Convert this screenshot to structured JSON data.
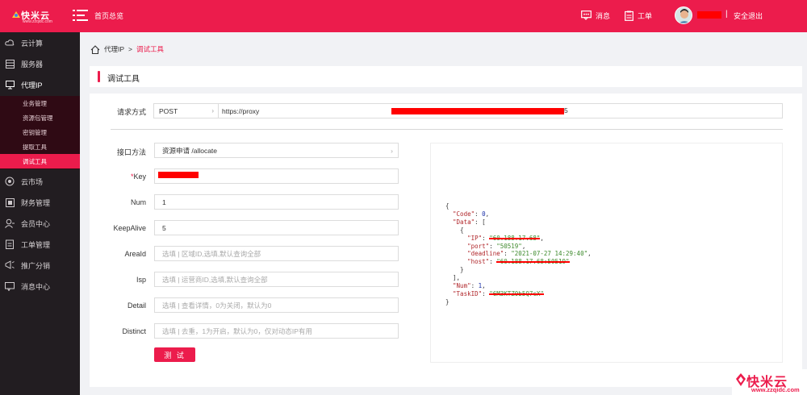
{
  "header": {
    "logo_name": "快米云",
    "logo_sub": "www.zzqidc.com",
    "home_label": "首页总览",
    "messages_label": "消息",
    "tickets_label": "工单",
    "separator": "|",
    "logout_label": "安全退出"
  },
  "sidebar": {
    "items": [
      {
        "label": "云计算",
        "icon": "cloud-icon"
      },
      {
        "label": "服务器",
        "icon": "server-icon"
      },
      {
        "label": "代理IP",
        "icon": "monitor-icon"
      },
      {
        "label": "云市场",
        "icon": "market-icon"
      },
      {
        "label": "财务管理",
        "icon": "finance-icon"
      },
      {
        "label": "会员中心",
        "icon": "user-icon"
      },
      {
        "label": "工单管理",
        "icon": "ticket-icon"
      },
      {
        "label": "推广分销",
        "icon": "promote-icon"
      },
      {
        "label": "消息中心",
        "icon": "message-icon"
      }
    ],
    "subitems": [
      "业务管理",
      "资源包管理",
      "密钥管理",
      "提取工具",
      "调试工具"
    ]
  },
  "breadcrumb": {
    "parent": "代理IP",
    "sep": ">",
    "current": "调试工具"
  },
  "page_title": "调试工具",
  "form": {
    "method_label": "请求方式",
    "method_value": "POST",
    "url_prefix": "https://proxy",
    "url_tail": "5",
    "api_label": "接口方法",
    "api_value": "资源申请  /allocate",
    "key_required": "*",
    "key_label": "Key",
    "num_label": "Num",
    "num_value": "1",
    "keepalive_label": "KeepAlive",
    "keepalive_value": "5",
    "areaid_label": "AreaId",
    "areaid_placeholder": "选填 | 区域ID,选填,默认查询全部",
    "isp_label": "Isp",
    "isp_placeholder": "选填 | 运营商ID,选填,默认查询全部",
    "detail_label": "Detail",
    "detail_placeholder": "选填 | 查看详情，0为关闭，默认为0",
    "distinct_label": "Distinct",
    "distinct_placeholder": "选填 | 去重，1为开启，默认为0，仅对动态IP有用",
    "test_button": "测 试"
  },
  "response": {
    "open_brace": "{",
    "close_brace": "}",
    "code_key": "\"Code\"",
    "code_val": "0",
    "data_key": "\"Data\"",
    "ip_key": "\"IP\"",
    "ip_val": "\"60.188.17.68\"",
    "port_key": "\"port\"",
    "port_val": "\"50519\"",
    "deadline_key": "\"deadline\"",
    "deadline_val": "\"2021-07-27 14:29:40\"",
    "host_key": "\"host\"",
    "host_val": "\"60.188.17.68:50519\"",
    "num_key": "\"Num\"",
    "num_val": "1",
    "taskid_key": "\"TaskID\"",
    "taskid_val": "\"6M3KTZ0b5Q7cX\""
  },
  "watermark": {
    "text": "快米云",
    "sub": "www.zzqidc.com"
  },
  "colors": {
    "accent": "#ec1c4c",
    "sidebar": "#221d21",
    "submenu": "#2f0a14"
  }
}
